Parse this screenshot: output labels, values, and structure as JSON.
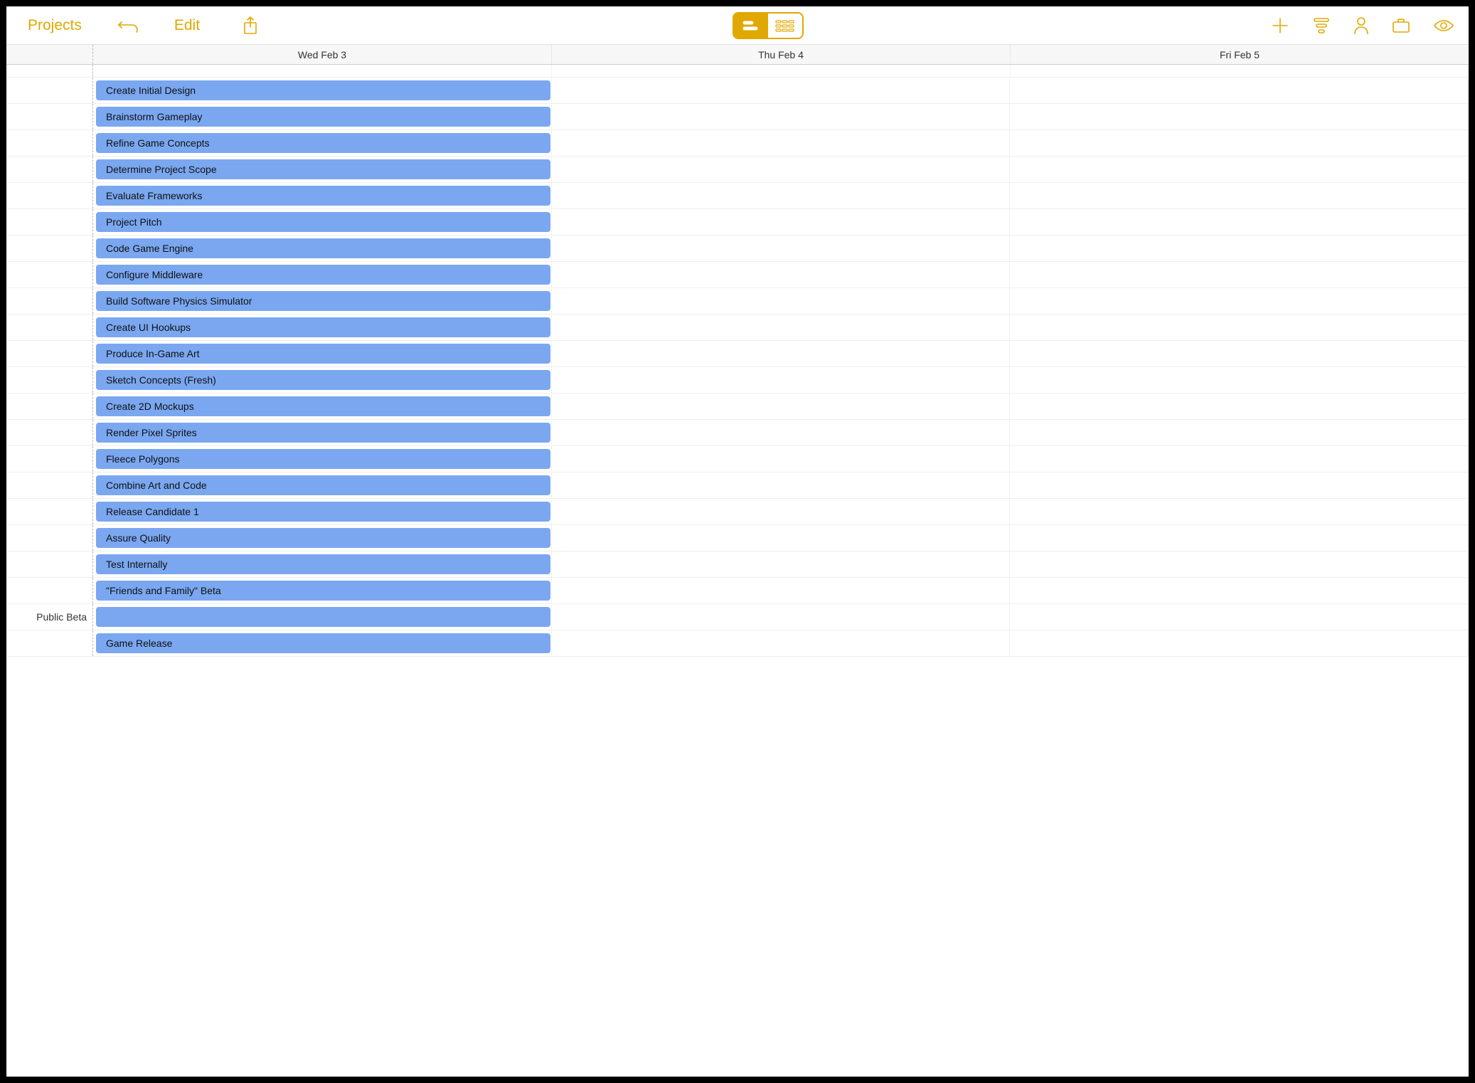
{
  "toolbar": {
    "projects": "Projects",
    "edit": "Edit"
  },
  "columns": [
    "Wed Feb 3",
    "Thu Feb 4",
    "Fri Feb 5"
  ],
  "rows": [
    {
      "label": "",
      "task": "Create Initial Design"
    },
    {
      "label": "",
      "task": "Brainstorm Gameplay"
    },
    {
      "label": "",
      "task": "Refine Game Concepts"
    },
    {
      "label": "",
      "task": "Determine Project Scope"
    },
    {
      "label": "",
      "task": "Evaluate Frameworks"
    },
    {
      "label": "",
      "task": "Project Pitch"
    },
    {
      "label": "",
      "task": "Code Game Engine"
    },
    {
      "label": "",
      "task": "Configure Middleware"
    },
    {
      "label": "",
      "task": "Build Software Physics Simulator"
    },
    {
      "label": "",
      "task": "Create UI Hookups"
    },
    {
      "label": "",
      "task": "Produce In-Game Art"
    },
    {
      "label": "",
      "task": "Sketch Concepts (Fresh)"
    },
    {
      "label": "",
      "task": "Create 2D Mockups"
    },
    {
      "label": "",
      "task": "Render Pixel Sprites"
    },
    {
      "label": "",
      "task": "Fleece Polygons"
    },
    {
      "label": "",
      "task": "Combine Art and Code"
    },
    {
      "label": "",
      "task": "Release Candidate 1"
    },
    {
      "label": "",
      "task": "Assure Quality"
    },
    {
      "label": "",
      "task": "Test Internally"
    },
    {
      "label": "",
      "task": "\"Friends and Family\" Beta"
    },
    {
      "label": "Public Beta",
      "task": ""
    },
    {
      "label": "",
      "task": "Game Release"
    }
  ]
}
